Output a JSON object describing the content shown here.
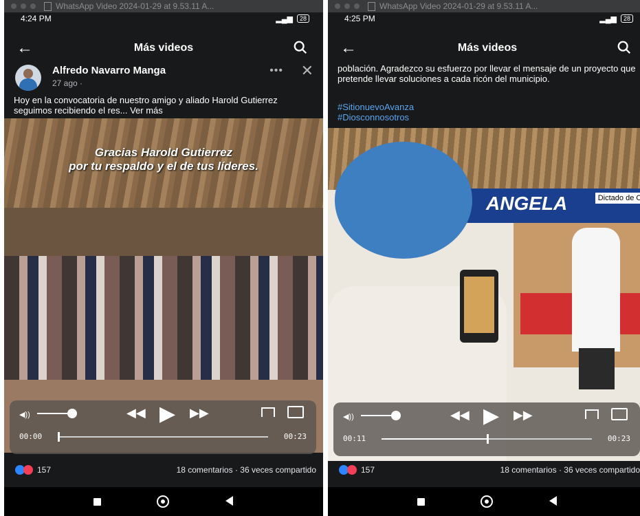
{
  "left": {
    "window_title": "WhatsApp Video 2024-01-29 at 9.53.11 A...",
    "status": {
      "time": "4:24 PM",
      "battery": "28"
    },
    "appbar": {
      "title": "Más videos"
    },
    "post": {
      "author": "Alfredo Navarro Manga",
      "time_ago": "27 ago ·",
      "text": "Hoy en la convocatoria de nuestro amigo y aliado Harold Gutierrez seguimos recibiendo el res... Ver más",
      "overlay_line1": "Gracias Harold Gutierrez",
      "overlay_line2": "por tu respaldo y el de tus líderes."
    },
    "player": {
      "current": "00:00",
      "duration": "00:23",
      "progress": 0.0
    },
    "reactions": {
      "count": "157",
      "stats": "18 comentarios · 36 veces compartido"
    }
  },
  "right": {
    "window_title": "WhatsApp Video 2024-01-29 at 9.53.11 A...",
    "status": {
      "time": "4:25 PM",
      "battery": "28"
    },
    "appbar": {
      "title": "Más videos"
    },
    "post": {
      "text": "población. Agradezco su esfuerzo por llevar el mensaje de un proyecto que pretende llevar soluciones a cada ricón del municipio.",
      "hashtag1": "#SitionuevoAvanza",
      "hashtag2": "#Diosconnosotros",
      "banner": "ANGELA",
      "dictado": "Dictado de Of"
    },
    "player": {
      "current": "00:11",
      "duration": "00:23",
      "progress": 0.5
    },
    "reactions": {
      "count": "157",
      "stats": "18 comentarios · 36 veces compartido"
    }
  },
  "icons": {
    "back": "arrow-left",
    "search": "magnifier",
    "more": "ellipsis",
    "close": "x",
    "rewind": "double-left",
    "play": "triangle-right",
    "forward": "double-right",
    "airplay": "airplay",
    "pip": "picture-in-picture"
  },
  "colors": {
    "background": "#18191a",
    "hashtag": "#5aa7f2",
    "like": "#2d86ff",
    "love": "#f33e58"
  }
}
